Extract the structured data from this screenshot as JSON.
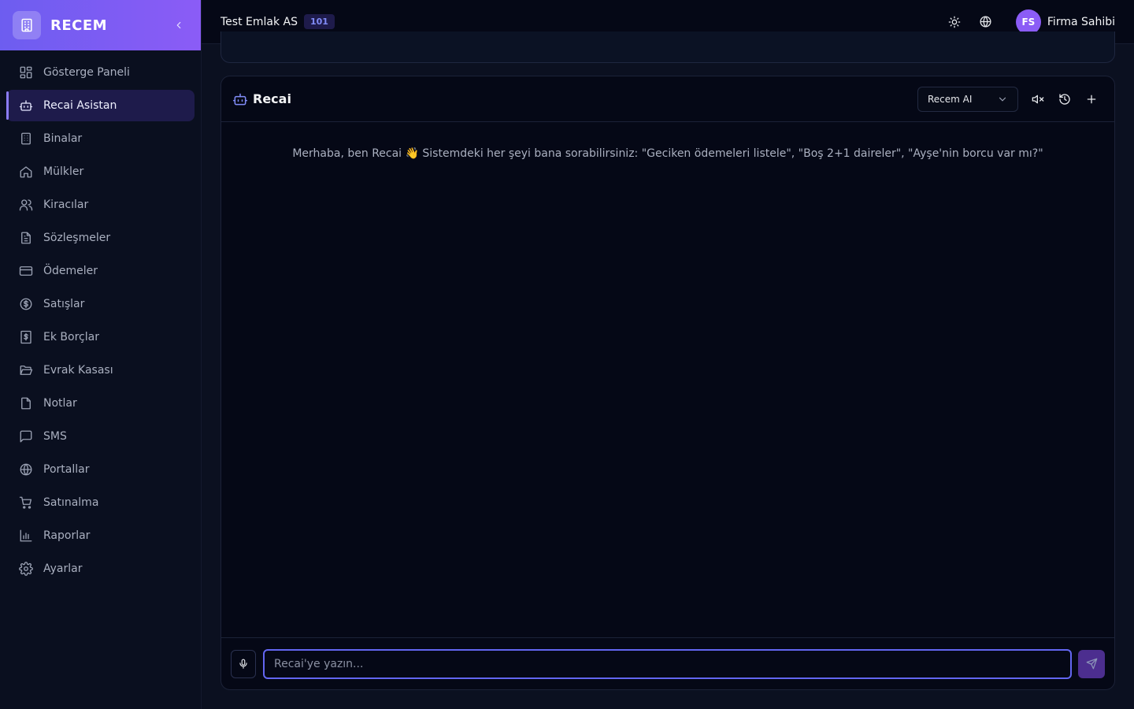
{
  "brand": {
    "name": "RECEM"
  },
  "sidebar": {
    "items": [
      {
        "label": "Gösterge Paneli",
        "icon": "dashboard-icon"
      },
      {
        "label": "Recai Asistan",
        "icon": "bot-icon",
        "active": true
      },
      {
        "label": "Binalar",
        "icon": "building-icon"
      },
      {
        "label": "Mülkler",
        "icon": "home-icon"
      },
      {
        "label": "Kiracılar",
        "icon": "users-icon"
      },
      {
        "label": "Sözleşmeler",
        "icon": "document-icon"
      },
      {
        "label": "Ödemeler",
        "icon": "credit-card-icon"
      },
      {
        "label": "Satışlar",
        "icon": "dollar-circle-icon"
      },
      {
        "label": "Ek Borçlar",
        "icon": "receipt-icon"
      },
      {
        "label": "Evrak Kasası",
        "icon": "folder-open-icon"
      },
      {
        "label": "Notlar",
        "icon": "note-icon"
      },
      {
        "label": "SMS",
        "icon": "message-icon"
      },
      {
        "label": "Portallar",
        "icon": "globe-icon"
      },
      {
        "label": "Satınalma",
        "icon": "cart-icon"
      },
      {
        "label": "Raporlar",
        "icon": "bar-chart-icon"
      },
      {
        "label": "Ayarlar",
        "icon": "gear-icon"
      }
    ]
  },
  "topbar": {
    "company": "Test Emlak AS",
    "company_badge": "101",
    "user_initials": "FS",
    "user_name": "Firma Sahibi"
  },
  "chat": {
    "title": "Recai",
    "model": "Recem AI",
    "welcome": "Merhaba, ben Recai 👋 Sistemdeki her şeyi bana sorabilirsiniz: \"Geciken ödemeleri listele\", \"Boş 2+1 daireler\", \"Ayşe'nin borcu var mı?\"",
    "input_placeholder": "Recai'ye yazın...",
    "input_value": ""
  },
  "colors": {
    "accent": "#6366f1",
    "brand_gradient_start": "#6d5df0",
    "brand_gradient_end": "#8b5cf6",
    "background": "#050816",
    "sidebar_active": "#1e1b4b"
  }
}
